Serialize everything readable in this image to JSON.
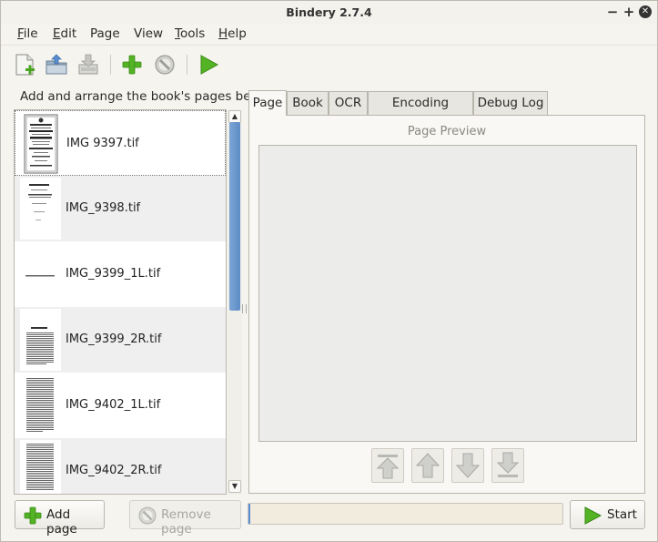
{
  "window": {
    "title": "Bindery 2.7.4"
  },
  "menubar": [
    {
      "first": "F",
      "rest": "ile"
    },
    {
      "first": "E",
      "rest": "dit"
    },
    {
      "first": "",
      "rest": "Page"
    },
    {
      "first": "",
      "rest": "View"
    },
    {
      "first": "T",
      "rest": "ools"
    },
    {
      "first": "H",
      "rest": "elp"
    }
  ],
  "toolbar": [
    "new-file-icon",
    "open-folder-icon",
    "save-icon",
    "add-icon",
    "remove-icon",
    "play-icon"
  ],
  "left": {
    "instruction": "Add and arrange the book's pages below",
    "pages": [
      {
        "name": "IMG 9397.tif",
        "selected": true
      },
      {
        "name": "IMG_9398.tif"
      },
      {
        "name": "IMG_9399_1L.tif"
      },
      {
        "name": "IMG_9399_2R.tif"
      },
      {
        "name": "IMG_9402_1L.tif"
      },
      {
        "name": "IMG_9402_2R.tif"
      }
    ]
  },
  "tabs": [
    {
      "label": "Page",
      "active": true
    },
    {
      "label": "Book"
    },
    {
      "label": "OCR"
    },
    {
      "label": "Encoding Options"
    },
    {
      "label": "Debug Log"
    }
  ],
  "page_tab": {
    "preview_label": "Page Preview"
  },
  "bottom": {
    "add_label": "Add page",
    "remove_label": "Remove page",
    "start_label": "Start",
    "progress_fraction": 0
  },
  "colors": {
    "accent_green": "#54b325",
    "scroll_blue": "#5c8cc6"
  }
}
